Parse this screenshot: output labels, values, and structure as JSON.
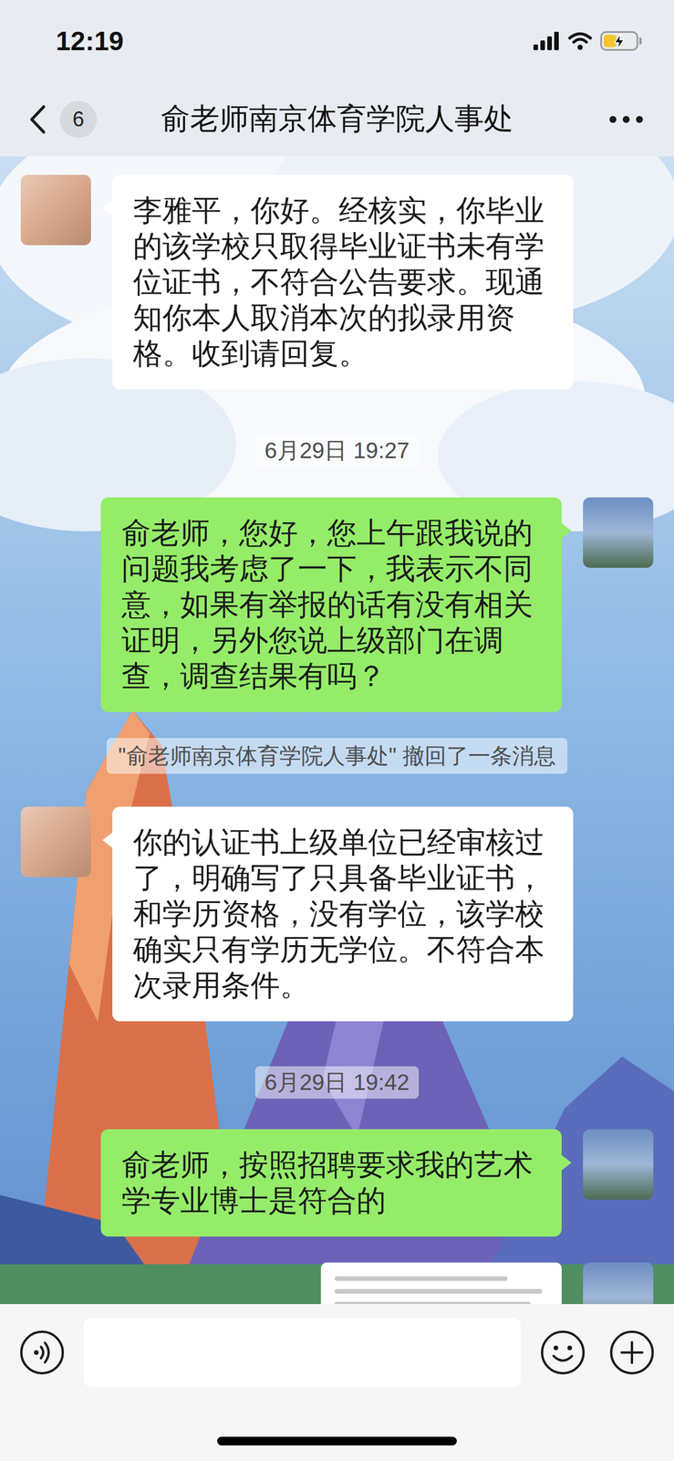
{
  "status_bar": {
    "time": "12:19",
    "battery_level": 0.4,
    "charging": true
  },
  "nav": {
    "unread_count": "6",
    "title": "俞老师南京体育学院人事处"
  },
  "messages": [
    {
      "kind": "text",
      "outgoing": false,
      "text": "李雅平，你好。经核实，你毕业的该学校只取得毕业证书未有学位证书，不符合公告要求。现通知你本人取消本次的拟录用资格。收到请回复。"
    },
    {
      "kind": "timestamp",
      "text": "6月29日 19:27"
    },
    {
      "kind": "text",
      "outgoing": true,
      "text": "俞老师，您好，您上午跟我说的问题我考虑了一下，我表示不同意，如果有举报的话有没有相关证明，另外您说上级部门在调查，调查结果有吗？"
    },
    {
      "kind": "system",
      "text": "\"俞老师南京体育学院人事处\" 撤回了一条消息"
    },
    {
      "kind": "text",
      "outgoing": false,
      "text": "你的认证书上级单位已经审核过了，明确写了只具备毕业证书，和学历资格，没有学位，该学校确实只有学历无学位。不符合本次录用条件。"
    },
    {
      "kind": "timestamp",
      "text": "6月29日 19:42"
    },
    {
      "kind": "text",
      "outgoing": true,
      "text": "俞老师，按照招聘要求我的艺术学专业博士是符合的"
    },
    {
      "kind": "image",
      "outgoing": true
    }
  ]
}
